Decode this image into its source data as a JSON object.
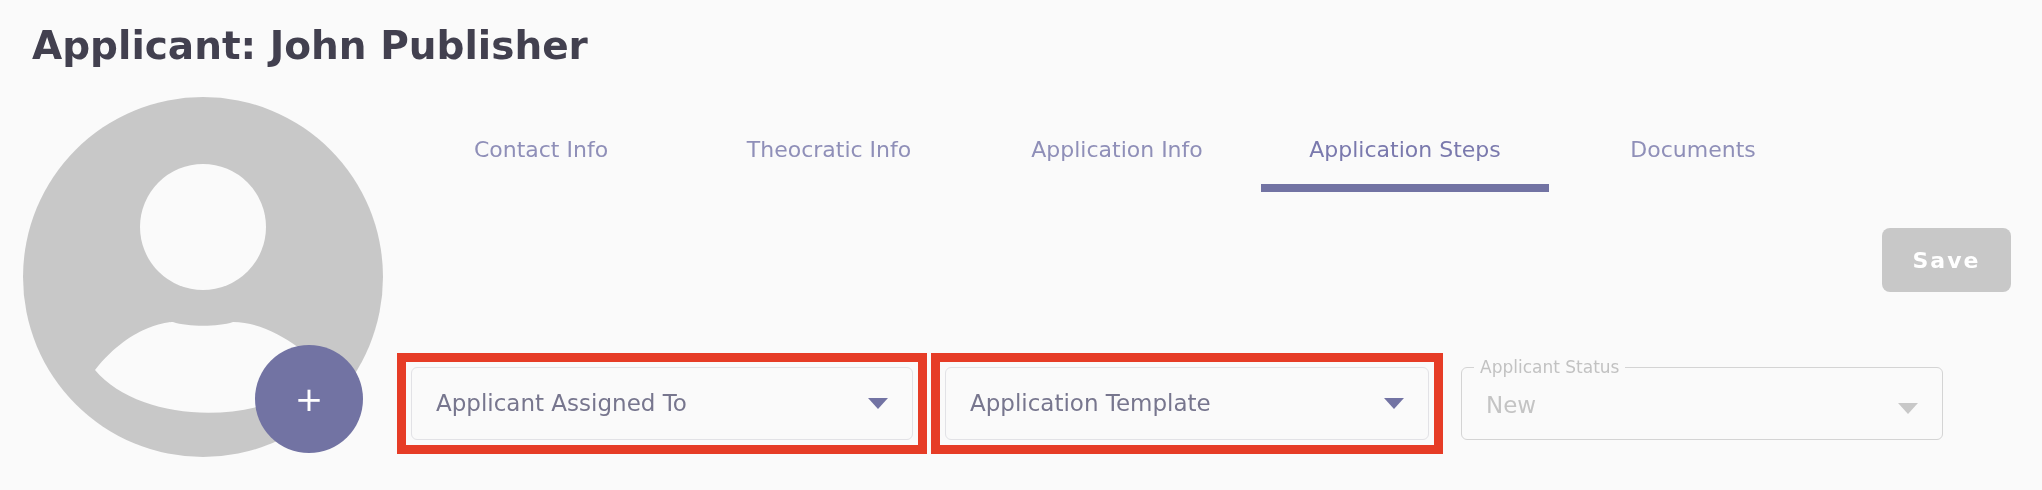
{
  "title": "Applicant: John Publisher",
  "avatar": {
    "add_button": "+"
  },
  "tabs": [
    {
      "label": "Contact Info",
      "selected": false
    },
    {
      "label": "Theocratic Info",
      "selected": false
    },
    {
      "label": "Application Info",
      "selected": false
    },
    {
      "label": "Application Steps",
      "selected": true
    },
    {
      "label": "Documents",
      "selected": false
    }
  ],
  "save_button": {
    "label": "Save",
    "disabled": true
  },
  "fields": [
    {
      "placeholder": "Applicant Assigned To",
      "highlighted": true,
      "disabled": false
    },
    {
      "placeholder": "Application Template",
      "highlighted": true,
      "disabled": false
    },
    {
      "label": "Applicant Status",
      "value": "New",
      "highlighted": false,
      "disabled": true
    }
  ]
}
